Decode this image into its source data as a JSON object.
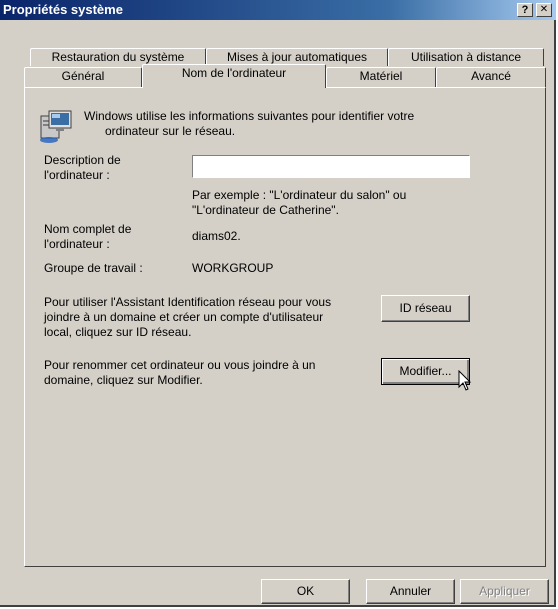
{
  "window": {
    "title": "Propriétés système",
    "help_label": "?",
    "close_label": "✕"
  },
  "tabs": {
    "row1": [
      {
        "label": "Restauration du système"
      },
      {
        "label": "Mises à jour automatiques"
      },
      {
        "label": "Utilisation à distance"
      }
    ],
    "row2": [
      {
        "label": "Général"
      },
      {
        "label": "Nom de l'ordinateur",
        "active": true
      },
      {
        "label": "Matériel"
      },
      {
        "label": "Avancé"
      }
    ]
  },
  "panel": {
    "intro_line1": "Windows utilise les informations suivantes pour identifier votre",
    "intro_line2": "ordinateur sur le réseau.",
    "description_label_1": "Description de",
    "description_label_2": "l'ordinateur :",
    "description_value": "",
    "description_placeholder": "",
    "example_line1": "Par exemple : \"L'ordinateur du salon\" ou",
    "example_line2": "\"L'ordinateur de Catherine\".",
    "fullname_label_1": "Nom complet de",
    "fullname_label_2": "l'ordinateur :",
    "fullname_value": "diams02.",
    "workgroup_label": "Groupe de travail :",
    "workgroup_value": "WORKGROUP",
    "network_id_text_1": "Pour utiliser l'Assistant Identification réseau pour vous",
    "network_id_text_2": "joindre à un domaine et créer un compte d'utilisateur",
    "network_id_text_3": "local, cliquez sur ID réseau.",
    "network_id_button": "ID réseau",
    "rename_text_1": "Pour renommer cet ordinateur ou vous joindre à un",
    "rename_text_2": "domaine, cliquez sur Modifier.",
    "modify_button": "Modifier..."
  },
  "footer": {
    "ok": "OK",
    "cancel": "Annuler",
    "apply": "Appliquer"
  },
  "colors": {
    "face": "#d4d0c8",
    "title_start": "#0a246a",
    "title_end": "#a6caf0"
  }
}
